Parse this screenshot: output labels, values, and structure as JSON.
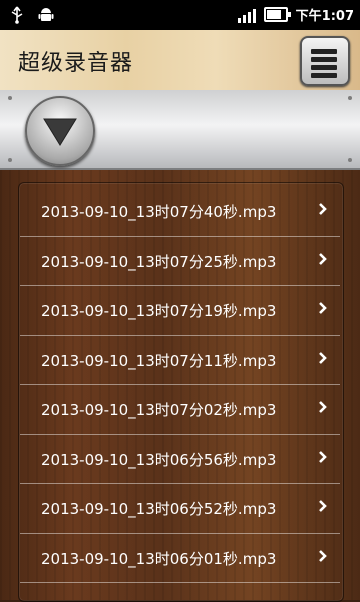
{
  "status_bar": {
    "time": "下午1:07",
    "icons": [
      "usb-icon",
      "android-icon",
      "signal-icon",
      "battery-icon"
    ],
    "battery_level": 0.7
  },
  "header": {
    "title": "超级录音器",
    "menu_icon": "list-menu-icon"
  },
  "player": {
    "button_icon": "down-triangle-icon"
  },
  "recordings": [
    {
      "name": "2013-09-10_13时07分40秒.mp3"
    },
    {
      "name": "2013-09-10_13时07分25秒.mp3"
    },
    {
      "name": "2013-09-10_13时07分19秒.mp3"
    },
    {
      "name": "2013-09-10_13时07分11秒.mp3"
    },
    {
      "name": "2013-09-10_13时07分02秒.mp3"
    },
    {
      "name": "2013-09-10_13时06分56秒.mp3"
    },
    {
      "name": "2013-09-10_13时06分52秒.mp3"
    },
    {
      "name": "2013-09-10_13时06分01秒.mp3"
    }
  ]
}
